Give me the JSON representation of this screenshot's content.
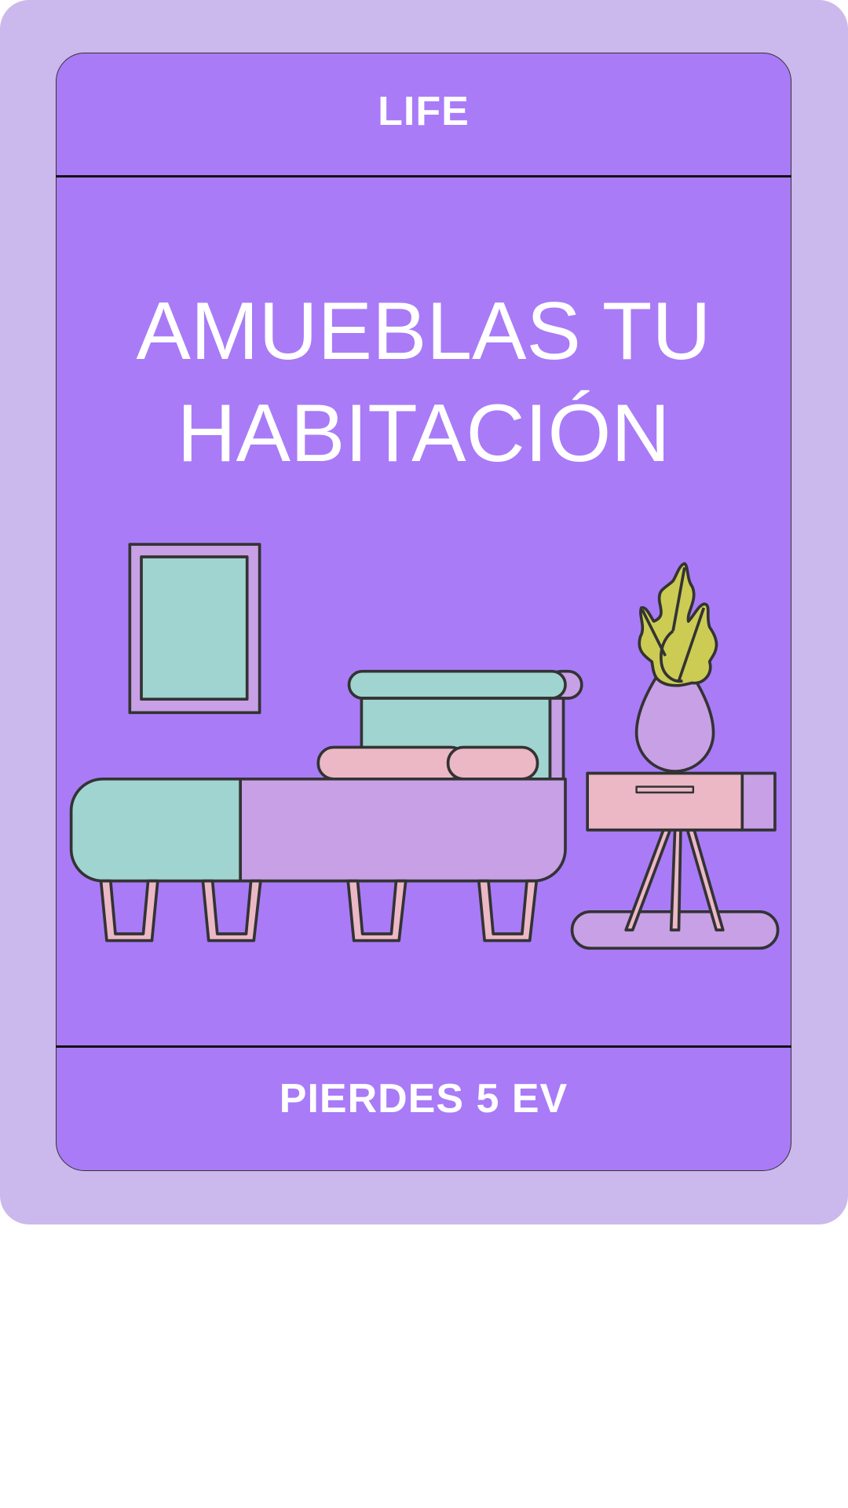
{
  "card": {
    "category": "LIFE",
    "title_line1": "AMUEBLAS TU",
    "title_line2": "HABITACIÓN",
    "effect": "PIERDES 5 EV"
  },
  "colors": {
    "background": "#cbb8ec",
    "card": "#a97bf7",
    "teal": "#a0d4d0",
    "lilac": "#c8a0e6",
    "pink": "#ecb8c6",
    "leaf": "#cccc55",
    "outline": "#333333"
  }
}
